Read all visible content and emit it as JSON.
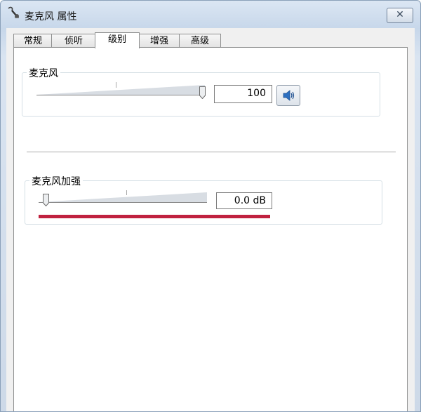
{
  "window": {
    "title": "麦克风 属性",
    "close_symbol": "✕"
  },
  "icons": {
    "title": "microphone-icon",
    "speaker": "speaker-icon"
  },
  "tabs": [
    {
      "label": "常规",
      "active": false
    },
    {
      "label": "侦听",
      "active": false
    },
    {
      "label": "级别",
      "active": true
    },
    {
      "label": "增强",
      "active": false
    },
    {
      "label": "高级",
      "active": false
    }
  ],
  "microphone": {
    "label": "麦克风",
    "value_text": "100",
    "level": 100
  },
  "boost": {
    "label": "麦克风加强",
    "value_text": "0.0 dB",
    "level": 0
  },
  "colors": {
    "annotation_underline": "#c0213f"
  }
}
